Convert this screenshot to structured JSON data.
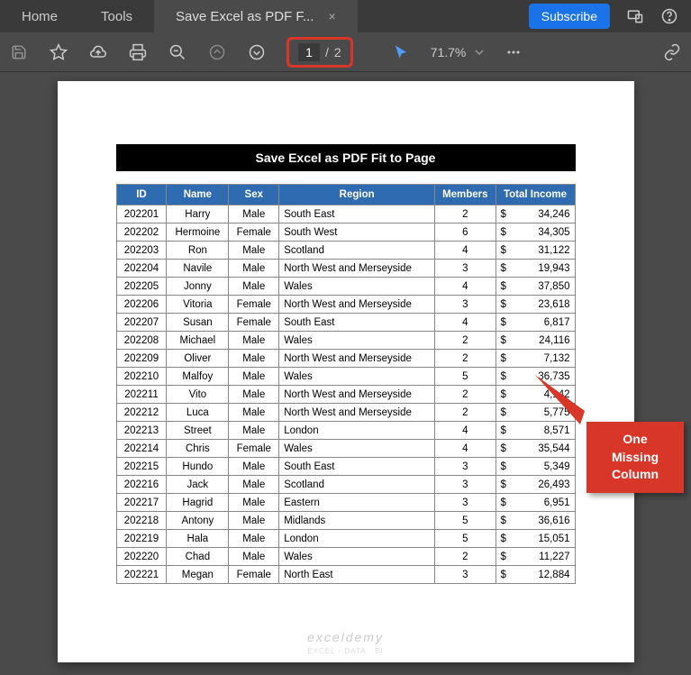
{
  "tabs": {
    "home": "Home",
    "tools": "Tools",
    "active": "Save Excel as PDF F...",
    "close": "×"
  },
  "topbar": {
    "subscribe": "Subscribe"
  },
  "toolbar": {
    "page_current": "1",
    "page_sep": "/",
    "page_total": "2",
    "zoom": "71.7%"
  },
  "document": {
    "title": "Save Excel as PDF Fit to Page",
    "headers": [
      "ID",
      "Name",
      "Sex",
      "Region",
      "Members",
      "Total Income"
    ],
    "rows": [
      {
        "id": "202201",
        "name": "Harry",
        "sex": "Male",
        "region": "South East",
        "members": "2",
        "income": "34,246"
      },
      {
        "id": "202202",
        "name": "Hermoine",
        "sex": "Female",
        "region": "South West",
        "members": "6",
        "income": "34,305"
      },
      {
        "id": "202203",
        "name": "Ron",
        "sex": "Male",
        "region": "Scotland",
        "members": "4",
        "income": "31,122"
      },
      {
        "id": "202204",
        "name": "Navile",
        "sex": "Male",
        "region": "North West and Merseyside",
        "members": "3",
        "income": "19,943"
      },
      {
        "id": "202205",
        "name": "Jonny",
        "sex": "Male",
        "region": "Wales",
        "members": "4",
        "income": "37,850"
      },
      {
        "id": "202206",
        "name": "Vitoria",
        "sex": "Female",
        "region": "North West and Merseyside",
        "members": "3",
        "income": "23,618"
      },
      {
        "id": "202207",
        "name": "Susan",
        "sex": "Female",
        "region": "South East",
        "members": "4",
        "income": "6,817"
      },
      {
        "id": "202208",
        "name": "Michael",
        "sex": "Male",
        "region": "Wales",
        "members": "2",
        "income": "24,116"
      },
      {
        "id": "202209",
        "name": "Oliver",
        "sex": "Male",
        "region": "North West and Merseyside",
        "members": "2",
        "income": "7,132"
      },
      {
        "id": "202210",
        "name": "Malfoy",
        "sex": "Male",
        "region": "Wales",
        "members": "5",
        "income": "36,735"
      },
      {
        "id": "202211",
        "name": "Vito",
        "sex": "Male",
        "region": "North West and Merseyside",
        "members": "2",
        "income": "4,142"
      },
      {
        "id": "202212",
        "name": "Luca",
        "sex": "Male",
        "region": "North West and Merseyside",
        "members": "2",
        "income": "5,775"
      },
      {
        "id": "202213",
        "name": "Street",
        "sex": "Male",
        "region": "London",
        "members": "4",
        "income": "8,571"
      },
      {
        "id": "202214",
        "name": "Chris",
        "sex": "Female",
        "region": "Wales",
        "members": "4",
        "income": "35,544"
      },
      {
        "id": "202215",
        "name": "Hundo",
        "sex": "Male",
        "region": "South East",
        "members": "3",
        "income": "5,349"
      },
      {
        "id": "202216",
        "name": "Jack",
        "sex": "Male",
        "region": "Scotland",
        "members": "3",
        "income": "26,493"
      },
      {
        "id": "202217",
        "name": "Hagrid",
        "sex": "Male",
        "region": "Eastern",
        "members": "3",
        "income": "6,951"
      },
      {
        "id": "202218",
        "name": "Antony",
        "sex": "Male",
        "region": "Midlands",
        "members": "5",
        "income": "36,616"
      },
      {
        "id": "202219",
        "name": "Hala",
        "sex": "Male",
        "region": "London",
        "members": "5",
        "income": "15,051"
      },
      {
        "id": "202220",
        "name": "Chad",
        "sex": "Male",
        "region": "Wales",
        "members": "2",
        "income": "11,227"
      },
      {
        "id": "202221",
        "name": "Megan",
        "sex": "Female",
        "region": "North East",
        "members": "3",
        "income": "12,884"
      }
    ],
    "dollar": "$",
    "watermark": "exceldemy",
    "watermark_sub": "EXCEL · DATA · BI"
  },
  "callout": {
    "line1": "One",
    "line2": "Missing",
    "line3": "Column"
  }
}
